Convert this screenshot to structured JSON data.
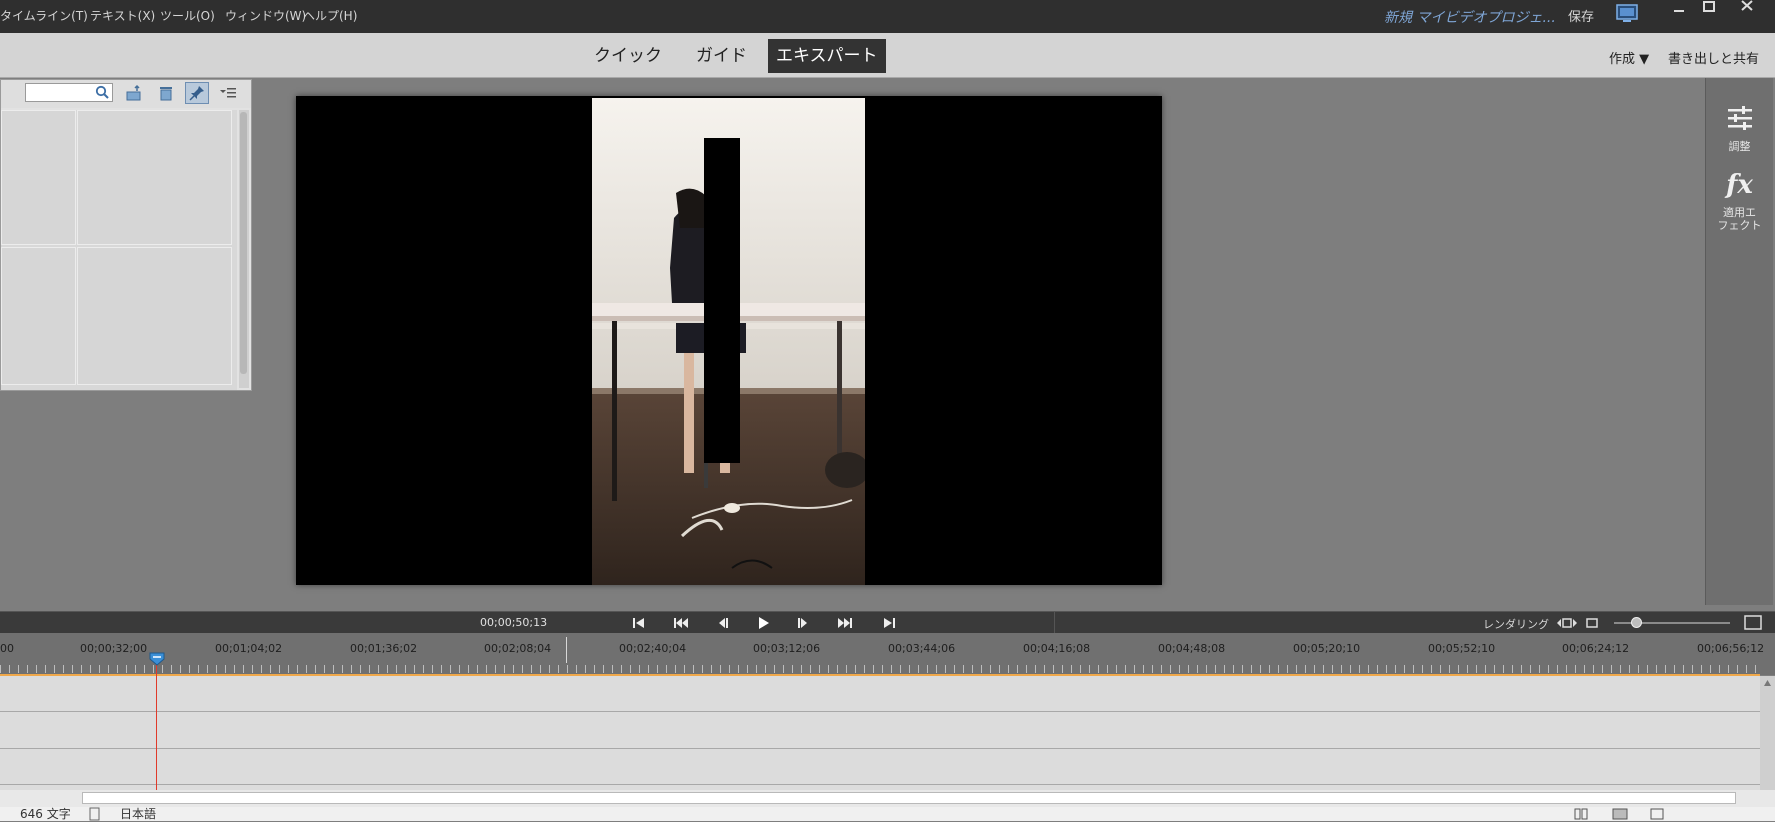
{
  "menu": {
    "items": [
      "タイムライン(T)",
      "テキスト(X)",
      "ツール(O)",
      "ウィンドウ(W)",
      "ヘルプ(H)"
    ],
    "project_title": "新規 マイビデオプロジェ...",
    "save_label": "保存"
  },
  "modes": {
    "tabs": [
      {
        "label": "クイック",
        "active": false
      },
      {
        "label": "ガイド",
        "active": false
      },
      {
        "label": "エキスパート",
        "active": true
      }
    ],
    "create_label": "作成 ▼",
    "export_label": "書き出しと共有"
  },
  "assets": {
    "search_value": ""
  },
  "right_panel": {
    "adjust_label": "調整",
    "fx_glyph": "fx",
    "effects_label_1": "適用エ",
    "effects_label_2": "フェクト"
  },
  "transport": {
    "timecode": "00;00;50;13",
    "render_label": "レンダリング"
  },
  "ruler": {
    "labels": [
      "00",
      "00;00;32;00",
      "00;01;04;02",
      "00;01;36;02",
      "00;02;08;04",
      "00;02;40;04",
      "00;03;12;06",
      "00;03;44;06",
      "00;04;16;08",
      "00;04;48;08",
      "00;05;20;10",
      "00;05;52;10",
      "00;06;24;12",
      "00;06;56;12"
    ]
  },
  "status": {
    "chars": "646 文字",
    "language": "日本語"
  },
  "colors": {
    "accent_active": "#333333",
    "title_link": "#7fa6d6",
    "playhead": "#e03a2a",
    "work_area": "#f0a84a"
  }
}
